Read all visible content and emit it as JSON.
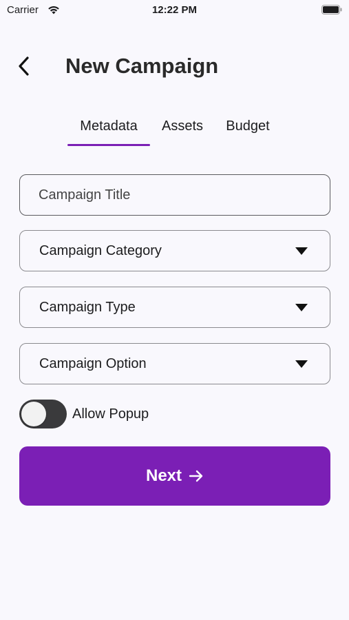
{
  "status_bar": {
    "carrier": "Carrier",
    "time": "12:22 PM",
    "wifi_icon": "wifi-icon",
    "battery_icon": "battery-icon"
  },
  "header": {
    "back_icon": "chevron-left-icon",
    "title": "New Campaign"
  },
  "tabs": [
    {
      "label": "Metadata",
      "active": true
    },
    {
      "label": "Assets",
      "active": false
    },
    {
      "label": "Budget",
      "active": false
    }
  ],
  "form": {
    "title_field": {
      "placeholder": "Campaign Title",
      "value": ""
    },
    "category_select": {
      "label": "Campaign Category",
      "icon": "caret-down-icon"
    },
    "type_select": {
      "label": "Campaign Type",
      "icon": "caret-down-icon"
    },
    "option_select": {
      "label": "Campaign Option",
      "icon": "caret-down-icon"
    },
    "popup_toggle": {
      "label": "Allow Popup",
      "on": false
    }
  },
  "next_button": {
    "label": "Next",
    "icon": "arrow-right-icon"
  },
  "colors": {
    "accent": "#7b1fb5",
    "background": "#f9f8fd",
    "toggle_track": "#3a3a3c"
  }
}
